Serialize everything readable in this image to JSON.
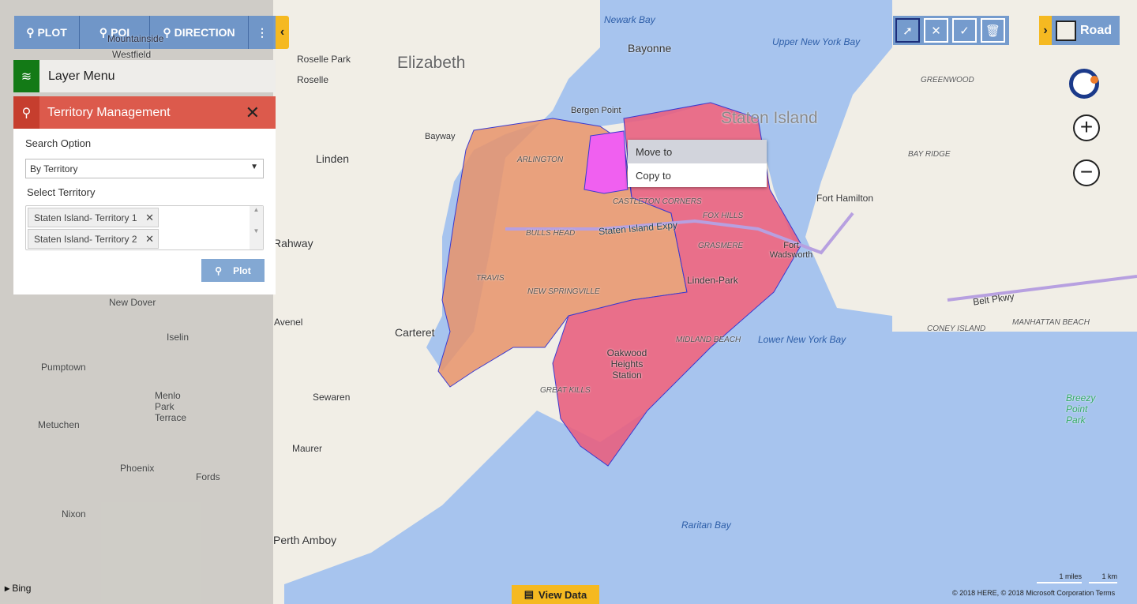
{
  "toolbar": {
    "plot": "PLOT",
    "poi": "POI",
    "direction": "DIRECTION",
    "more_icon": "vertical-dots",
    "collapse_icon": "chevron-left"
  },
  "layer_menu": {
    "label": "Layer Menu",
    "icon": "layers"
  },
  "territory_panel": {
    "title": "Territory Management",
    "icon": "map-pin",
    "close": "✕",
    "search_option_label": "Search Option",
    "search_option_value": "By Territory",
    "select_territory_label": "Select Territory",
    "selected": [
      "Staten Island- Territory 1",
      "Staten Island- Territory 2"
    ],
    "plot_button": "Plot"
  },
  "context_menu": [
    "Move to",
    "Copy to"
  ],
  "map_type": {
    "label": "Road"
  },
  "zoom": {
    "in": "+",
    "out": "−"
  },
  "view_data": "View Data",
  "scale": {
    "miles": "1 miles",
    "km": "1 km"
  },
  "copyright": "© 2018 HERE, © 2018 Microsoft Corporation  Terms",
  "bing": "Bing",
  "colors": {
    "territory1": "#e8936a",
    "territory2": "#e8607f",
    "selected": "#f060f0",
    "water": "#a7c4ee",
    "land": "#f1eee6",
    "accent": "#f5b921",
    "toolbar": "#5f8cc8",
    "territory_header": "#dc5a4c",
    "layer_icon_bg": "#137a16"
  },
  "map_labels": {
    "elizabeth": "Elizabeth",
    "bayonne": "Bayonne",
    "staten": "Staten Island",
    "linden": "Linden",
    "rahway": "Rahway",
    "carteret": "Carteret",
    "avenel": "Avenel",
    "iselin": "Iselin",
    "metuchen": "Metuchen",
    "fords": "Fords",
    "perth": "Perth Amboy",
    "roselle_park": "Roselle Park",
    "roselle": "Roselle",
    "upper_bay": "Upper New York Bay",
    "lower_bay": "Lower New York Bay",
    "raritan_bay": "Raritan Bay",
    "newark_bay": "Newark Bay",
    "fort_hamilton": "Fort Hamilton",
    "linden_park": "Linden-Park",
    "oakwood": "Oakwood Heights Station",
    "castleton": "CASTLETON CORNERS",
    "new_springville": "NEW SPRINGVILLE",
    "bulls_head": "BULLS HEAD",
    "travis": "TRAVIS",
    "arlington": "ARLINGTON",
    "great_kills": "GREAT KILLS",
    "midland": "MIDLAND BEACH",
    "grasmere": "GRASMERE",
    "fox_hills": "FOX HILLS",
    "si_expy": "Staten Island Expy",
    "belt": "Belt Pkwy",
    "bay_ridge": "BAY RIDGE",
    "greenwood": "GREENWOOD",
    "new_dover": "New Dover",
    "pumptown": "Pumptown",
    "menlo": "Menlo Park Terrace",
    "nixon": "Nixon",
    "phoenix": "Phoenix",
    "sewaren": "Sewaren",
    "maurer": "Maurer",
    "westfield": "Westfield",
    "mountainside": "Mountainside",
    "breezy": "Breezy Point Park",
    "coney": "CONEY ISLAND",
    "manhattan_beach": "MANHATTAN BEACH",
    "bergen_point": "Bergen Point",
    "fort_wadsworth": "Fort Wadsworth",
    "bayway": "Bayway"
  }
}
